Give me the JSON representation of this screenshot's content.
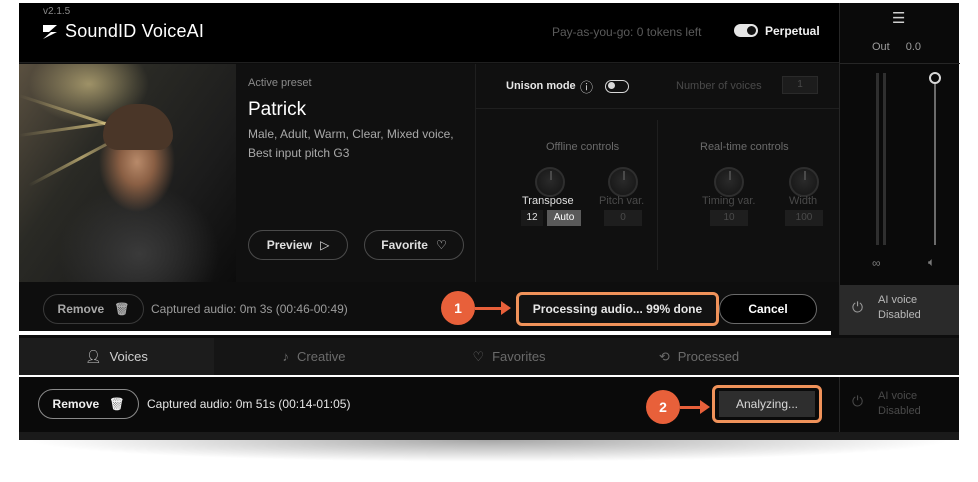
{
  "app": {
    "version": "v2.1.5",
    "brand": "SoundID VoiceAI",
    "tokens": "Pay-as-you-go: 0 tokens left",
    "license_mode": "Perpetual"
  },
  "output": {
    "label": "Out",
    "value": "0.0"
  },
  "preset": {
    "active_label": "Active preset",
    "name": "Patrick",
    "description": "Male, Adult, Warm, Clear, Mixed voice, Best input pitch  G3",
    "preview_label": "Preview",
    "favorite_label": "Favorite"
  },
  "controls": {
    "unison_label": "Unison mode",
    "voices_label": "Number of voices",
    "voices_value": "1",
    "offline_title": "Offline controls",
    "realtime_title": "Real-time controls",
    "transpose_label": "Transpose",
    "transpose_value": "12",
    "transpose_auto": "Auto",
    "pitch_var_label": "Pitch var.",
    "pitch_var_value": "0",
    "timing_var_label": "Timing var.",
    "timing_var_value": "10",
    "width_label": "Width",
    "width_value": "100"
  },
  "action_bar": {
    "remove_label": "Remove",
    "captured": "Captured audio: 0m 3s (00:46-00:49)",
    "processing": "Processing audio... 99% done",
    "cancel_label": "Cancel",
    "progress_percent": 99
  },
  "ai_voice": {
    "line1": "AI voice",
    "line2": "Disabled"
  },
  "tabs": [
    {
      "label": "Voices"
    },
    {
      "label": "Creative"
    },
    {
      "label": "Favorites"
    },
    {
      "label": "Processed"
    }
  ],
  "bottom_bar": {
    "remove_label": "Remove",
    "captured": "Captured audio: 0m 51s (00:14-01:05)",
    "analyzing": "Analyzing...",
    "ai_line1": "AI voice",
    "ai_line2": "Disabled"
  },
  "callouts": {
    "one": "1",
    "two": "2"
  },
  "colors": {
    "accent": "#f0925a",
    "badge": "#e8603a",
    "background": "#0d0d0d"
  }
}
